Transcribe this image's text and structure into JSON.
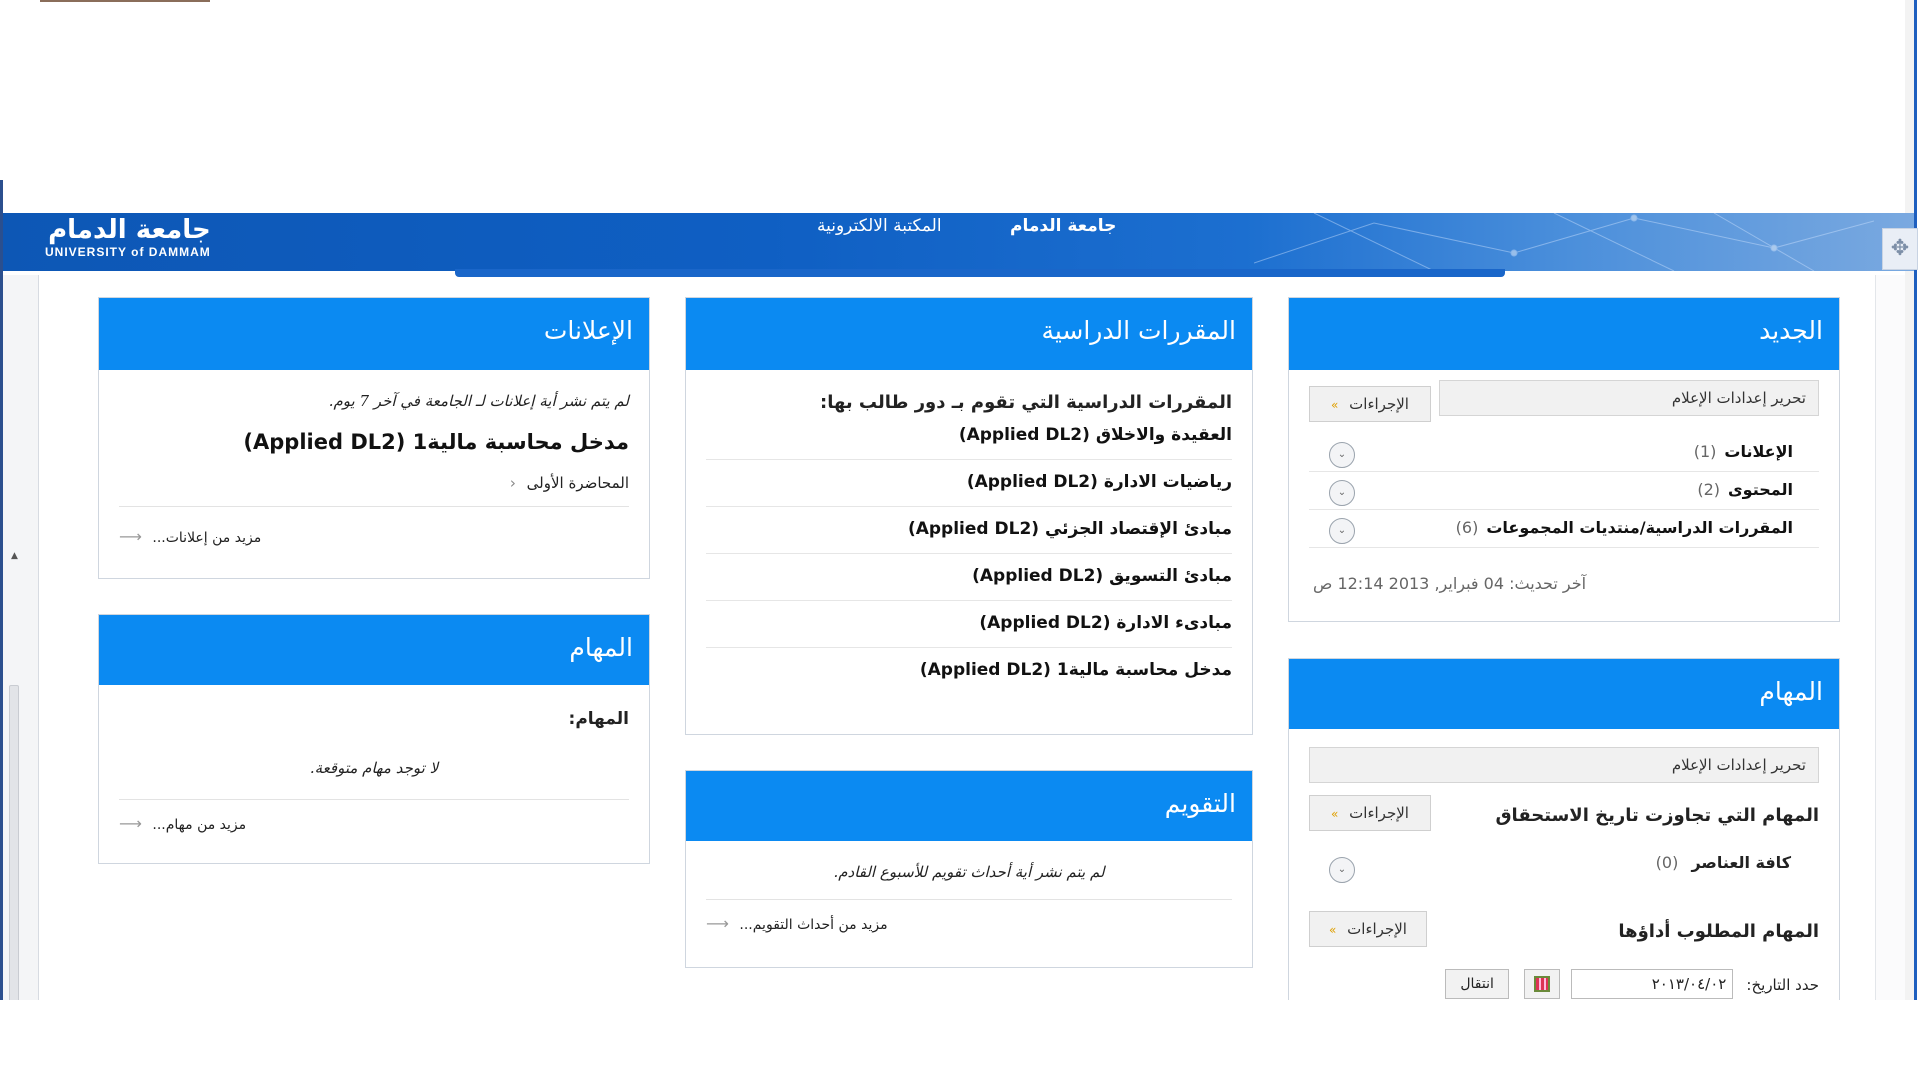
{
  "header": {
    "logo_ar": "جامعة الدمام",
    "logo_en": "UNIVERSITY of DAMMAM",
    "nav": [
      "جامعة الدمام",
      "المكتبة الالكترونية"
    ]
  },
  "announcements": {
    "title": "الإعلانات",
    "note": "لم يتم نشر أية إعلانات لـ الجامعة في آخر 7 يوم.",
    "course": "مدخل محاسبة مالية1 (Applied DL2)",
    "item": "المحاضرة الأولى",
    "more": "مزيد من إعلانات..."
  },
  "tasks_left": {
    "title": "المهام",
    "label": "المهام:",
    "note": "لا توجد مهام متوقعة.",
    "more": "مزيد من مهام..."
  },
  "courses": {
    "title": "المقررات الدراسية",
    "intro": "المقررات الدراسية التي تقوم بـ دور طالب بها:",
    "items": [
      "العقيدة والاخلاق (Applied DL2)",
      "رياضيات الادارة (Applied DL2)",
      "مبادئ الإقتصاد الجزئي (Applied DL2)",
      "مبادئ التسويق (Applied DL2)",
      "مبادىء الادارة (Applied DL2)",
      "مدخل محاسبة مالية1 (Applied DL2)"
    ]
  },
  "calendar": {
    "title": "التقويم",
    "note": "لم يتم نشر أية أحداث تقويم للأسبوع القادم.",
    "more": "مزيد من أحداث التقويم..."
  },
  "whats_new": {
    "title": "الجديد",
    "edit": "تحرير إعدادات الإعلام",
    "actions": "الإجراءات",
    "rows": [
      {
        "label": "الإعلانات",
        "count": "(1)"
      },
      {
        "label": "المحتوى",
        "count": "(2)"
      },
      {
        "label": "المقررات الدراسية/منتديات المجموعات",
        "count": "(6)"
      }
    ],
    "updated": "آخر تحديث: 04 فبراير, 2013 12:14 ص"
  },
  "tasks_right": {
    "title": "المهام",
    "edit": "تحرير إعدادات الإعلام",
    "actions": "الإجراءات",
    "overdue": "المهام التي تجاوزت تاريخ الاستحقاق",
    "all_items": "كافة العناصر",
    "all_count": "(0)",
    "due": "المهام المطلوب أداؤها",
    "due_actions": "الإجراءات",
    "date_label": "حدد التاريخ:",
    "date_value": "٢٠١٣/٠٤/٠٢",
    "go": "انتقال"
  },
  "colors": {
    "panel_header": "#0b8af2",
    "banner": "#0d57b5"
  }
}
